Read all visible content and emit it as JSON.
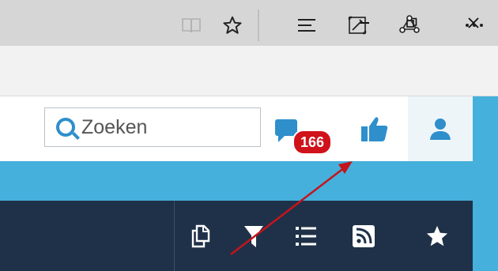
{
  "window": {
    "minimize_icon": "minimize-icon",
    "restore_icon": "restore-icon",
    "close_icon": "close-icon"
  },
  "browser_toolbar": {
    "icons": [
      "reading-view-icon",
      "favorite-star-icon",
      "hub-icon",
      "web-note-icon",
      "share-icon",
      "more-icon"
    ]
  },
  "header": {
    "search": {
      "placeholder": "Zoeken"
    },
    "notifications": {
      "count": "166"
    },
    "icons": [
      "chat-icon",
      "thumbs-up-icon",
      "user-icon"
    ]
  },
  "nav": {
    "icons": [
      "copy-icon",
      "filter-icon",
      "list-icon",
      "rss-icon",
      "star-icon"
    ]
  },
  "colors": {
    "accent_blue": "#2e8fcb",
    "band_blue": "#45b0db",
    "navy": "#1f3148",
    "badge_red": "#d0121b",
    "arrow_red": "#c4141c"
  }
}
